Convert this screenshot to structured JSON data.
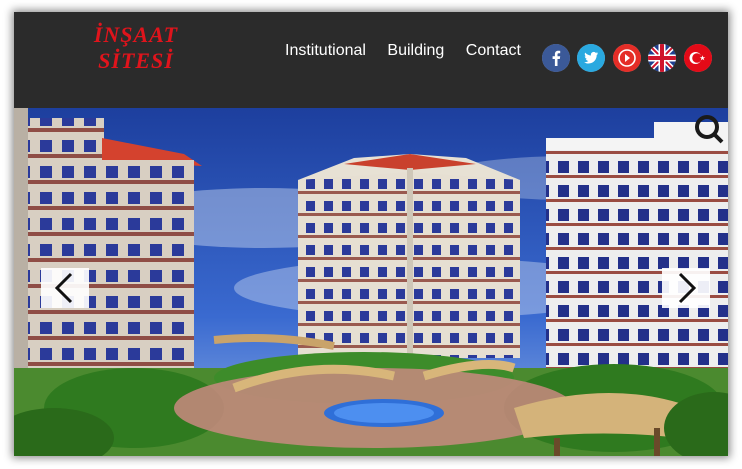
{
  "logo": {
    "line1": "İNŞAAT",
    "line2": "SİTESİ"
  },
  "nav": {
    "items": [
      "Institutional",
      "Building",
      "Contact"
    ]
  },
  "social": {
    "icons": [
      "facebook-icon",
      "twitter-icon",
      "youtube-icon",
      "uk-flag-icon",
      "turkey-flag-icon"
    ]
  },
  "colors": {
    "header_bg": "#2b2b2b",
    "logo_red": "#e0141c",
    "sky": "#2a4fb8"
  }
}
